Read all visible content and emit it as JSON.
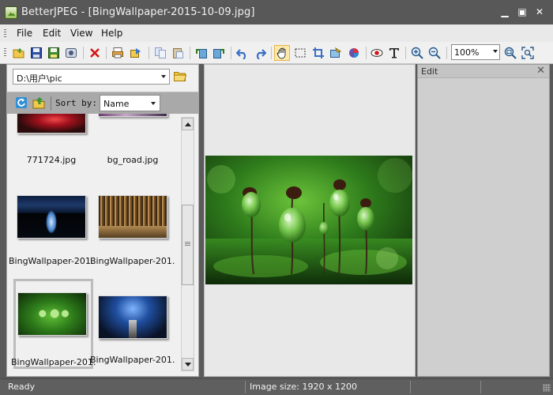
{
  "window": {
    "app_name": "BetterJPEG",
    "title": "BetterJPEG - [BingWallpaper-2015-10-09.jpg]"
  },
  "menu": [
    "File",
    "Edit",
    "View",
    "Help"
  ],
  "toolbar": {
    "icons": [
      "open-icon",
      "save-icon",
      "save-as-icon",
      "save-all-icon",
      "delete-icon",
      "print-icon",
      "batch-icon",
      "copy-icon",
      "paste-icon",
      "rotate-left-icon",
      "rotate-right-icon",
      "undo-icon",
      "redo-icon",
      "hand-tool-icon",
      "select-tool-icon",
      "crop-icon",
      "adjust-icon",
      "color-icon",
      "red-eye-icon",
      "text-tool-icon",
      "zoom-in-icon",
      "zoom-out-icon",
      "zoom-fit-icon",
      "zoom-actual-icon"
    ],
    "zoom": "100%",
    "hand_tool_active": true
  },
  "browser": {
    "path": "D:\\用户\\pic",
    "sort_label": "Sort by:",
    "sort_value": "Name",
    "thumbnails": [
      {
        "caption": "771724.jpg",
        "palette": [
          "#2b0b0b",
          "#c11a2a",
          "#3a0c0a"
        ],
        "selected": false
      },
      {
        "caption": "bg_road.jpg",
        "palette": [
          "#3b2a4a",
          "#c9a7c9",
          "#6a3a6f"
        ],
        "selected": false
      },
      {
        "caption": "BingWallpaper-201...",
        "palette": [
          "#0a1226",
          "#3a6aa6",
          "#0a0a0a"
        ],
        "selected": false
      },
      {
        "caption": "BingWallpaper-201...",
        "palette": [
          "#6b4a23",
          "#c8a36a",
          "#3b2a14"
        ],
        "selected": false
      },
      {
        "caption": "BingWallpaper-201...",
        "palette": [
          "#1d4a12",
          "#4fa32a",
          "#0e2a08"
        ],
        "selected": true
      },
      {
        "caption": "BingWallpaper-201...",
        "palette": [
          "#0a1a3a",
          "#2a5aa0",
          "#111"
        ],
        "selected": false
      }
    ]
  },
  "edit_panel": {
    "title": "Edit",
    "close": "✕"
  },
  "status": {
    "ready": "Ready",
    "image_size": "Image size:  1920 x 1200"
  },
  "colors": {
    "titlebar": "#585858",
    "statusbar": "#5f5f5f",
    "toolbar": "#f0f0f0",
    "selection": "#fde9a8"
  }
}
